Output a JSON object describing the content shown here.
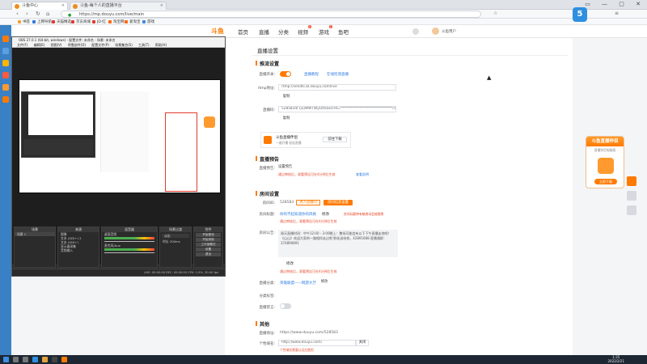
{
  "browser": {
    "tabs": [
      {
        "label": "斗鱼中心"
      },
      {
        "label": "斗鱼-每个人的直播平台"
      }
    ],
    "url": "https://mp.douyu.com/live/main",
    "bookmarks": [
      "书签",
      "上网导航",
      "天猫精选",
      "京东商城",
      "JD·红",
      "淘宝网",
      "爱淘宝",
      "游戏"
    ]
  },
  "header": {
    "logo": "斗鱼",
    "nav": [
      "首页",
      "直播",
      "分类",
      "视频",
      "游戏",
      "鱼吧"
    ],
    "nav_badges": {
      "视频": "2",
      "游戏": "1"
    },
    "user": "斗鱼用户"
  },
  "obs": {
    "title": "OBS 27.0.1 (64-bit, windows) - 配置文件: 未命名 - 场景: 未命名",
    "menu": [
      "文件(F)",
      "编辑(E)",
      "视图(V)",
      "停靠部件(D)",
      "配置文件(P)",
      "场景集合(S)",
      "工具(T)",
      "帮助(H)"
    ],
    "docks": [
      {
        "title": "场景",
        "rows": [
          "场景 1"
        ]
      },
      {
        "title": "来源",
        "rows": [
          "图像",
          "文本 (GDI+) 2",
          "文本 (GDI+)",
          "显示器采集",
          "音频输入"
        ]
      },
      {
        "title": "混音器",
        "rows": [
          "桌面音频",
          "麦克风/Aux"
        ]
      },
      {
        "title": "场景过渡",
        "rows": [
          "淡出",
          "时长 300ms"
        ]
      },
      {
        "title": "控件",
        "rows": [
          "开始推流",
          "开始录制",
          "工作室模式",
          "设置",
          "退出"
        ]
      }
    ],
    "status": "LIVE: 00:00:00   REC: 00:00:00   CPU: 1.9%, 30.00 fps"
  },
  "settings": {
    "title": "直播设置",
    "push": {
      "section": "推流设置",
      "switch_label": "直播开关:",
      "switch_on": true,
      "links": [
        "直播教程",
        "在线检测直播"
      ],
      "rtmp_label": "rtmp地址:",
      "rtmp_value": "rtmp://sendtc3a.douyu.com/live",
      "copy1": "复制",
      "code_label": "直播码:",
      "code_value": "5285834rTj\\uWWTWyU/txSecret=******************************/Tcm7",
      "copy2": "复制",
      "tool_title": "斗鱼直播伴侣",
      "tool_sub": "一键开播 轻松直播",
      "tool_btn": "前往下载"
    },
    "notice": {
      "section": "直播预告",
      "label": "直播预告:",
      "btn": "设置预告",
      "note": "通过审核后，观看预告可在4分钟后生效",
      "note_link": "查看说明"
    },
    "room": {
      "section": "房间设置",
      "room_label": "房间ID:",
      "room_value": "528583",
      "room_btn1": "进入直播间",
      "room_btn2": "房间信息设置",
      "name_label": "房间标题:",
      "name_value": "你的不起知道你的风格",
      "name_btn": "修改",
      "name_note": "房间标题带有敏感词会被替换",
      "name_warn": "通过审核后，观看预告可在4分钟后生效",
      "cover_label": "房间公告:",
      "cover_text": "周天直播时间：中午12:00 - 3:00晚上：整场可能会有以下下午直播走他吧！《山山》欢迎大家的一路相伴走过吧 鲜花送给他，42891688 直播通群：374890891",
      "cover_btn": "修改",
      "cover_note": "通过审核后，观看预告可在4分钟后生效",
      "cat_label": "直播分类:",
      "cat_value": "英雄联盟——网游大厅",
      "cat_btn": "修改",
      "bg_label": "分类标签:",
      "bg_toggle_label": "直播禁言:",
      "bg_toggle_on": false
    },
    "other": {
      "section": "其他",
      "addr_label": "直播地址:",
      "addr_value": "https://www.douyu.com/528583",
      "share_label": "个性域名:",
      "share_value": "http://www.douyu.com/",
      "share_btn": "关闭",
      "share_note": "个性域名需要认证后使用"
    }
  },
  "ad": {
    "title": "斗鱼直播伴侣",
    "sub": "直播伴侣电脑版",
    "btn": "立即下载"
  },
  "taskbar": {
    "time": "1:35",
    "date": "2022/2/21"
  }
}
